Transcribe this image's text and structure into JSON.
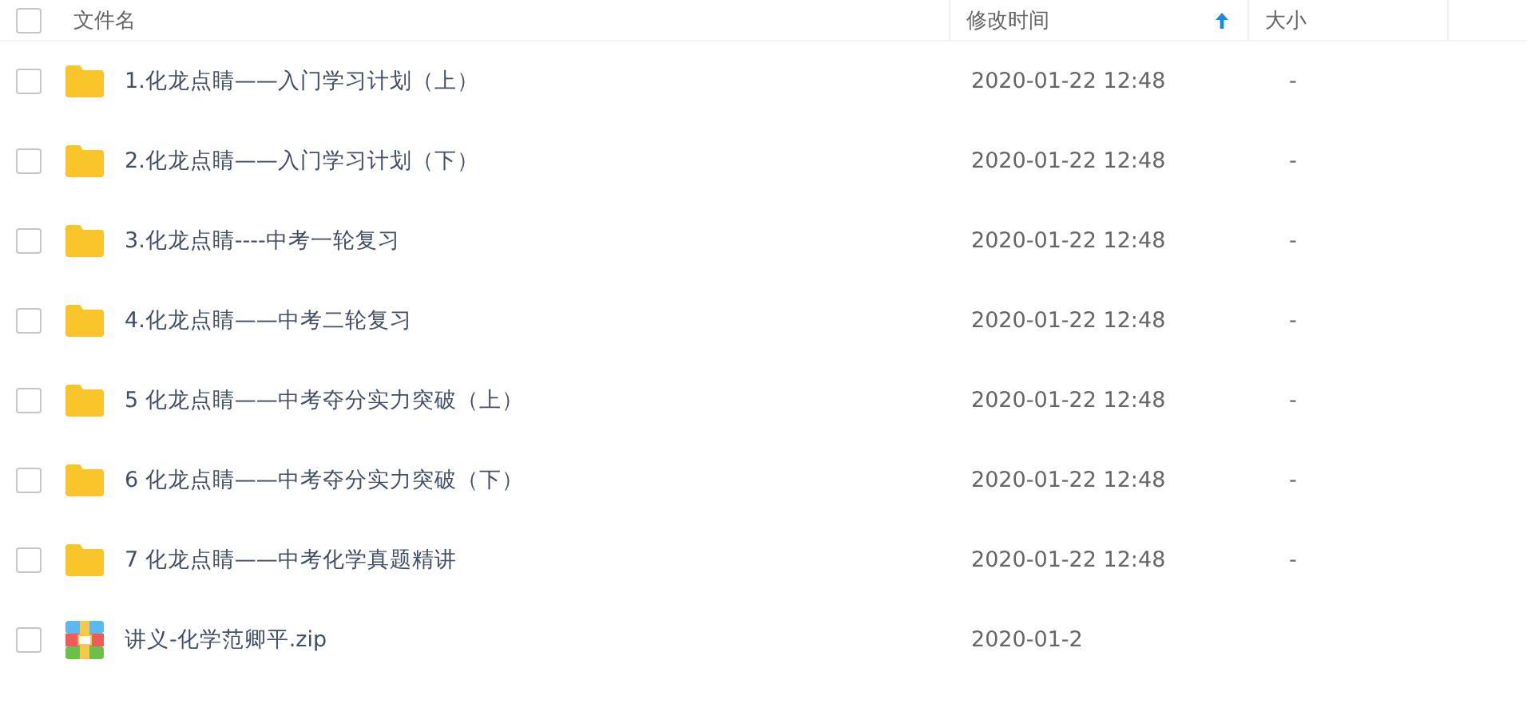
{
  "header": {
    "checked": false,
    "columns": [
      {
        "label": "文件名",
        "sorted": false
      },
      {
        "label": "修改时间",
        "sorted": true
      },
      {
        "label": "大小",
        "sorted": false
      }
    ]
  },
  "rows": [
    {
      "kind": "folder",
      "checked": false,
      "name": "1.化龙点睛——入门学习计划（上）",
      "modified": "2020-01-22 12:48",
      "size": "-"
    },
    {
      "kind": "folder",
      "checked": false,
      "name": "2.化龙点睛——入门学习计划（下）",
      "modified": "2020-01-22 12:48",
      "size": "-"
    },
    {
      "kind": "folder",
      "checked": false,
      "name": "3.化龙点睛----中考一轮复习",
      "modified": "2020-01-22 12:48",
      "size": "-"
    },
    {
      "kind": "folder",
      "checked": false,
      "name": "4.化龙点睛——中考二轮复习",
      "modified": "2020-01-22 12:48",
      "size": "-"
    },
    {
      "kind": "folder",
      "checked": false,
      "name": "5 化龙点睛——中考夺分实力突破（上）",
      "modified": "2020-01-22 12:48",
      "size": "-"
    },
    {
      "kind": "folder",
      "checked": false,
      "name": "6 化龙点睛——中考夺分实力突破（下）",
      "modified": "2020-01-22 12:48",
      "size": "-"
    },
    {
      "kind": "folder",
      "checked": false,
      "name": "7 化龙点睛——中考化学真题精讲",
      "modified": "2020-01-22 12:48",
      "size": "-"
    },
    {
      "kind": "archive",
      "checked": false,
      "name": "讲义-化学范卿平.zip",
      "modified": "2020-01-2"
    }
  ]
}
